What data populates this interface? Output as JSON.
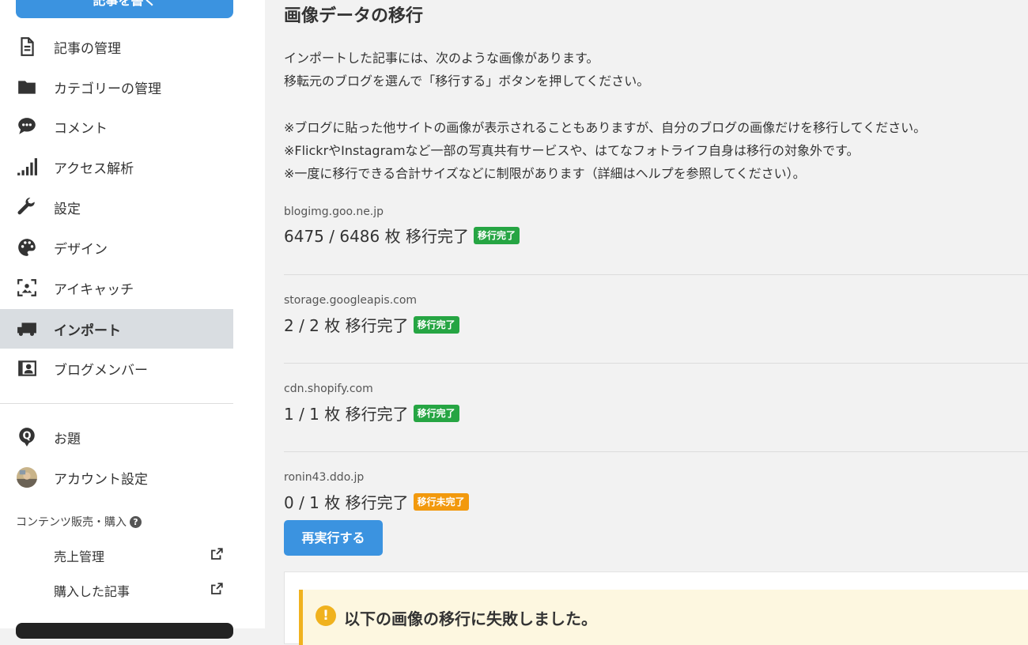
{
  "sidebar": {
    "write_button": "記事を書く",
    "items": [
      {
        "label": "記事の管理",
        "icon": "document-icon"
      },
      {
        "label": "カテゴリーの管理",
        "icon": "folder-icon"
      },
      {
        "label": "コメント",
        "icon": "comment-icon"
      },
      {
        "label": "アクセス解析",
        "icon": "signal-bars-icon"
      },
      {
        "label": "設定",
        "icon": "wrench-icon"
      },
      {
        "label": "デザイン",
        "icon": "palette-icon"
      },
      {
        "label": "アイキャッチ",
        "icon": "eyecatch-icon"
      },
      {
        "label": "インポート",
        "icon": "truck-icon",
        "active": true
      },
      {
        "label": "ブログメンバー",
        "icon": "member-card-icon"
      }
    ],
    "secondary_items": [
      {
        "label": "お題",
        "icon": "q-badge-icon"
      },
      {
        "label": "アカウント設定",
        "icon": "avatar"
      }
    ],
    "content_sales": {
      "title": "コンテンツ販売・購入",
      "help": "?",
      "items": [
        {
          "label": "売上管理"
        },
        {
          "label": "購入した記事"
        }
      ]
    }
  },
  "main": {
    "title": "画像データの移行",
    "intro": [
      "インポートした記事には、次のような画像があります。",
      "移転元のブログを選んで「移行する」ボタンを押してください。"
    ],
    "notes": [
      "※ブログに貼った他サイトの画像が表示されることもありますが、自分のブログの画像だけを移行してください。",
      "※FlickrやInstagramなど一部の写真共有サービスや、はてなフォトライフ自身は移行の対象外です。",
      "※一度に移行できる合計サイズなどに制限があります（詳細はヘルプを参照してください）。"
    ],
    "sources": [
      {
        "domain": "blogimg.goo.ne.jp",
        "count": "6475 / 6486 枚 移行完了",
        "badge": "移行完了",
        "status": "done"
      },
      {
        "domain": "storage.googleapis.com",
        "count": "2 / 2 枚 移行完了",
        "badge": "移行完了",
        "status": "done"
      },
      {
        "domain": "cdn.shopify.com",
        "count": "1 / 1 枚 移行完了",
        "badge": "移行完了",
        "status": "done"
      },
      {
        "domain": "ronin43.ddo.jp",
        "count": "0 / 1 枚 移行完了",
        "badge": "移行未完了",
        "status": "undone"
      }
    ],
    "rerun_button": "再実行する",
    "failure_alert": {
      "icon": "!",
      "text": "以下の画像の移行に失敗しました。"
    }
  },
  "colors": {
    "accent_blue": "#3b93e0",
    "done_green": "#26a543",
    "undone_orange": "#f2990d",
    "alert_yellow": "#f0b21e"
  }
}
